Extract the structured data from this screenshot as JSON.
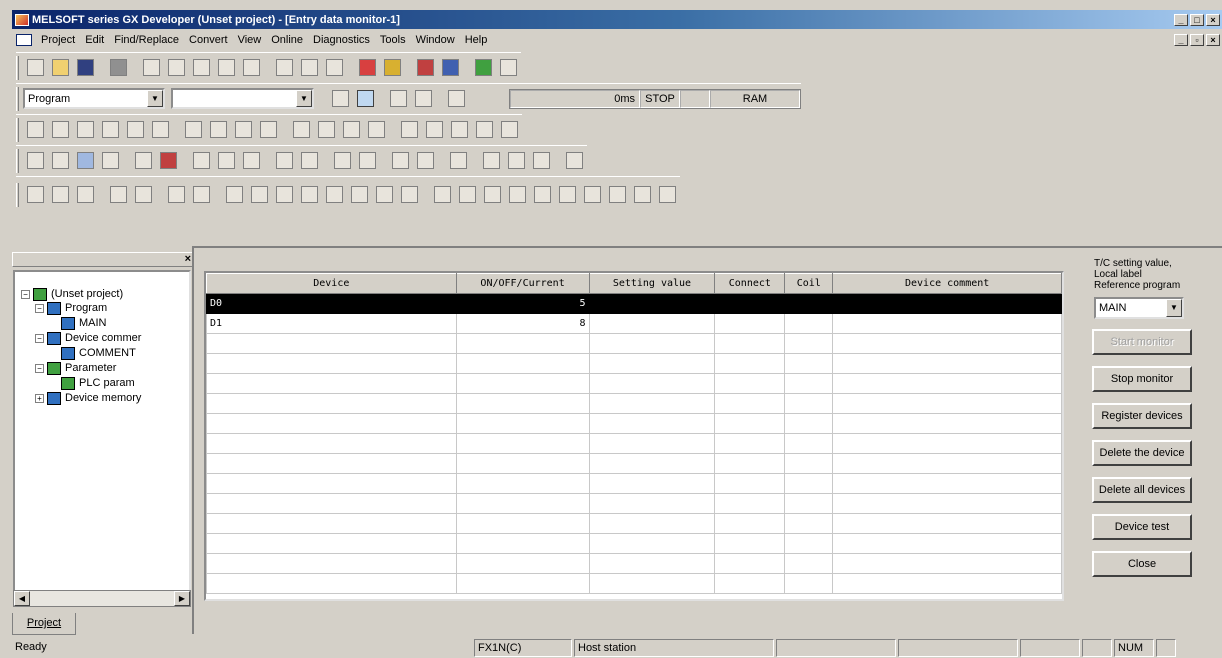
{
  "title": "MELSOFT series GX Developer (Unset project) - [Entry data monitor-1]",
  "menu": [
    "Project",
    "Edit",
    "Find/Replace",
    "Convert",
    "View",
    "Online",
    "Diagnostics",
    "Tools",
    "Window",
    "Help"
  ],
  "toolbar": {
    "combo1_value": "Program",
    "combo2_value": "",
    "status_time": "0ms",
    "status_state": "STOP",
    "status_mem": "RAM"
  },
  "tree": {
    "root": "(Unset project)",
    "program": "Program",
    "main": "MAIN",
    "device_comment": "Device commer",
    "comment": "COMMENT",
    "parameter": "Parameter",
    "plc_param": "PLC param",
    "device_memory": "Device memory"
  },
  "project_tab": "Project",
  "grid": {
    "headers": [
      "Device",
      "ON/OFF/Current",
      "Setting value",
      "Connect",
      "Coil",
      "Device comment"
    ],
    "rows": [
      {
        "device": "D0",
        "value": "5"
      },
      {
        "device": "D1",
        "value": "8"
      }
    ]
  },
  "side": {
    "label1": "T/C setting value,",
    "label2": "Local label",
    "label3": "Reference program",
    "program_value": "MAIN",
    "start_monitor": "Start monitor",
    "stop_monitor": "Stop monitor",
    "register_devices": "Register devices",
    "delete_device": "Delete the device",
    "delete_all": "Delete all devices",
    "device_test": "Device test",
    "close": "Close"
  },
  "status": {
    "ready": "Ready",
    "cpu": "FX1N(C)",
    "station": "Host station",
    "num": "NUM"
  }
}
